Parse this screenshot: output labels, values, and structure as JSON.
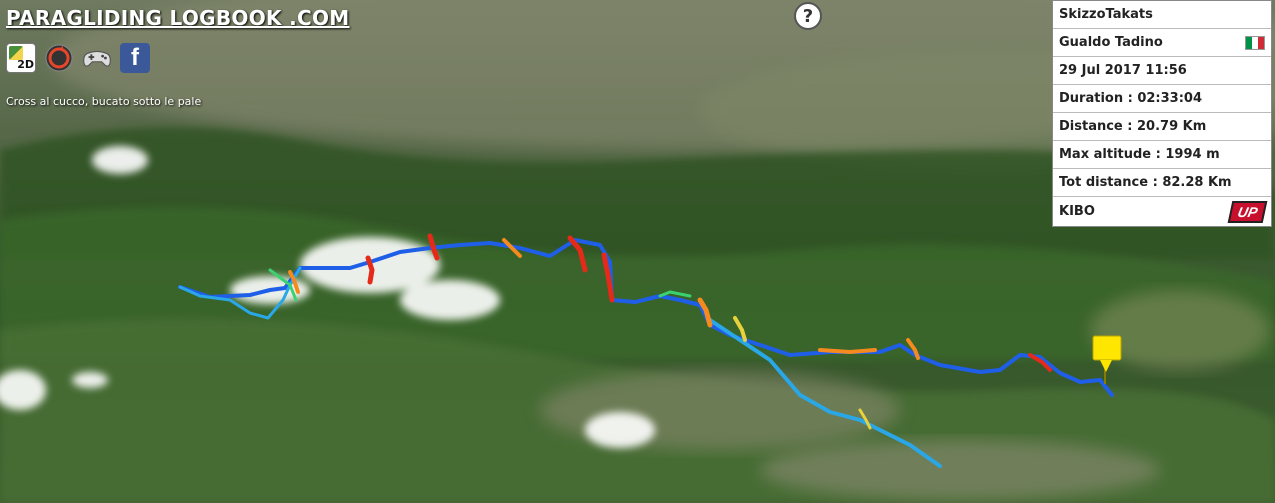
{
  "site": {
    "title": "PARAGLIDING LOGBOOK .COM",
    "caption": "Cross al cucco, bucato sotto le pale"
  },
  "icons": [
    {
      "name": "google-maps-2d-icon",
      "label": "2D"
    },
    {
      "name": "replay-icon"
    },
    {
      "name": "gamepad-icon"
    },
    {
      "name": "facebook-icon",
      "label": "f"
    }
  ],
  "help": {
    "label": "?"
  },
  "info_panel": {
    "pilot": "SkizzoTakats",
    "takeoff": "Gualdo Tadino",
    "date": "29 Jul 2017 11:56",
    "duration": "Duration : 02:33:04",
    "distance": "Distance : 20.79 Km",
    "max_altitude": "Max altitude : 1994 m",
    "tot_distance": "Tot distance : 82.28 Km",
    "wing": "KIBO",
    "wing_brand": "UP",
    "flag_colors": [
      "#009246",
      "#ffffff",
      "#ce2b37"
    ]
  },
  "map": {
    "track_colors": [
      "#1f5fe8",
      "#2aa7e6",
      "#3ad16f",
      "#e8d23a",
      "#f58a1f",
      "#e52a1a"
    ],
    "landing_marker_color": "#ffe600"
  }
}
